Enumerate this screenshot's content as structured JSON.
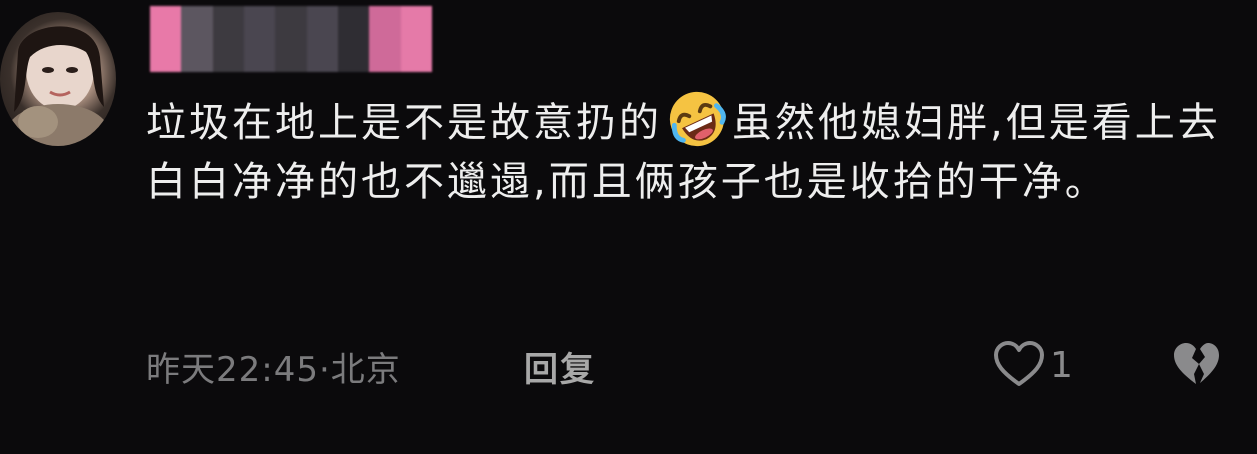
{
  "comment": {
    "avatar_icon": "user-avatar-photo",
    "username_hidden": true,
    "username_mosaic_colors": [
      "#e879a8",
      "#5c5660",
      "#3d3a40",
      "#4a4650",
      "#3d3a40",
      "#4a4650",
      "#2f2d33",
      "#cf6a99",
      "#e57aa8"
    ],
    "text_part1": "垃圾在地上是不是故意扔的",
    "emoji_icon": "rolling-on-floor-laughing-emoji",
    "text_part2": "虽然他媳妇胖,但是看上去白白净净的也不邋遢,而且俩孩子也是收拾的干净。",
    "timestamp": "昨天22:45·北京",
    "reply_label": "回复",
    "like_icon": "heart-outline-icon",
    "like_count": "1",
    "dislike_icon": "broken-heart-icon"
  },
  "colors": {
    "background": "#0b0a0c",
    "text": "#eeeeee",
    "meta_text": "#7b7b7d",
    "reply_text": "#a8a8a8"
  }
}
